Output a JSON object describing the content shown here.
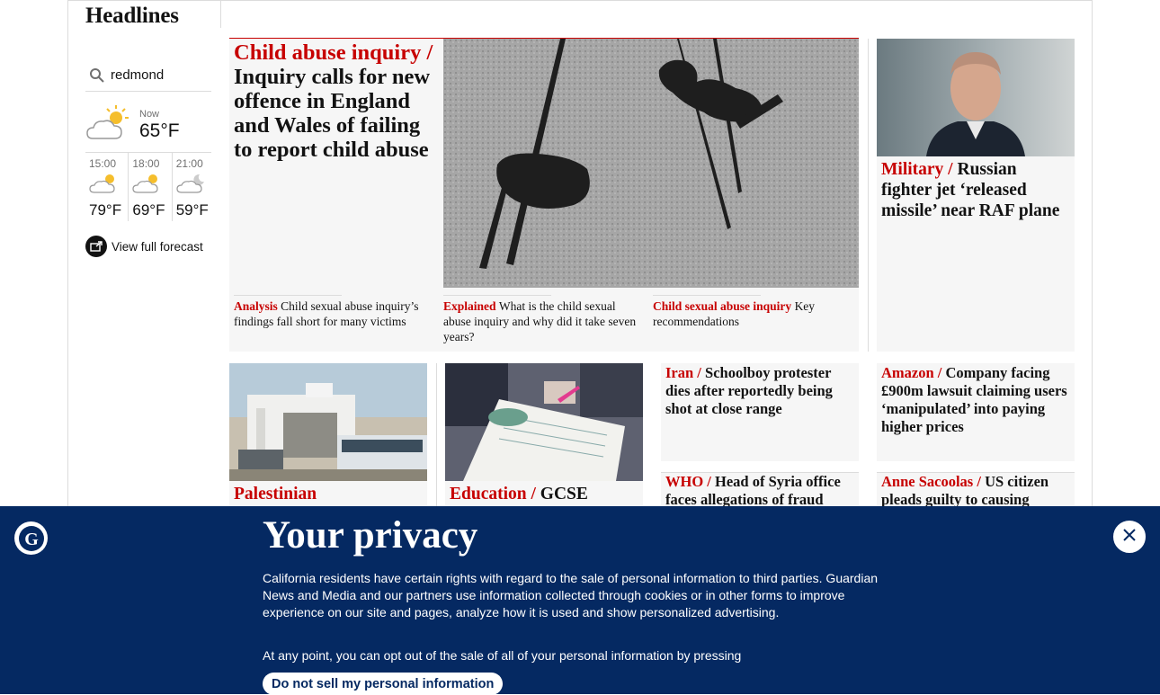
{
  "section": {
    "title": "Headlines"
  },
  "weather": {
    "location": "redmond",
    "now_label": "Now",
    "now_temp": "65°F",
    "forecast": [
      {
        "time": "15:00",
        "temp": "79°F"
      },
      {
        "time": "18:00",
        "temp": "69°F"
      },
      {
        "time": "21:00",
        "temp": "59°F"
      }
    ],
    "full_forecast": "View full forecast"
  },
  "main": {
    "kicker": "Child abuse inquiry /",
    "headline": "Inquiry calls for new offence in England and Wales of failing to report child abuse",
    "subs": [
      {
        "kicker": "Analysis",
        "headline": "Child sexual abuse inquiry’s findings fall short for many victims"
      },
      {
        "kicker": "Explained",
        "headline": "What is the child sexual abuse inquiry and why did it take seven years?"
      },
      {
        "kicker": "Child sexual abuse inquiry",
        "headline": "Key recommendations"
      }
    ]
  },
  "military": {
    "kicker": "Military /",
    "headline": "Russian fighter jet ‘released missile’ near RAF plane"
  },
  "row2": {
    "palestinian": {
      "kicker": "Palestinian"
    },
    "education": {
      "kicker": "Education /",
      "headline": "GCSE"
    },
    "iran": {
      "kicker": "Iran /",
      "headline": "Schoolboy protester dies after reportedly being shot at close range"
    },
    "amazon": {
      "kicker": "Amazon /",
      "headline": "Company facing £900m lawsuit claiming users ‘manipulated’ into paying higher prices"
    },
    "who": {
      "kicker": "WHO /",
      "headline": "Head of Syria office faces allegations of fraud"
    },
    "sacoolas": {
      "kicker": "Anne Sacoolas /",
      "headline": "US citizen pleads guilty to causing"
    }
  },
  "privacy": {
    "title": "Your privacy",
    "p1": "California residents have certain rights with regard to the sale of personal information to third parties. Guardian News and Media and our partners use information collected through cookies or in other forms to improve experience on our site and pages, analyze how it is used and show personalized advertising.",
    "p2": "At any point, you can opt out of the sale of all of your personal information by pressing",
    "button": "Do not sell my personal information"
  },
  "colors": {
    "brand": "#052962",
    "news_red": "#c70000",
    "card_bg": "#f6f6f6"
  }
}
